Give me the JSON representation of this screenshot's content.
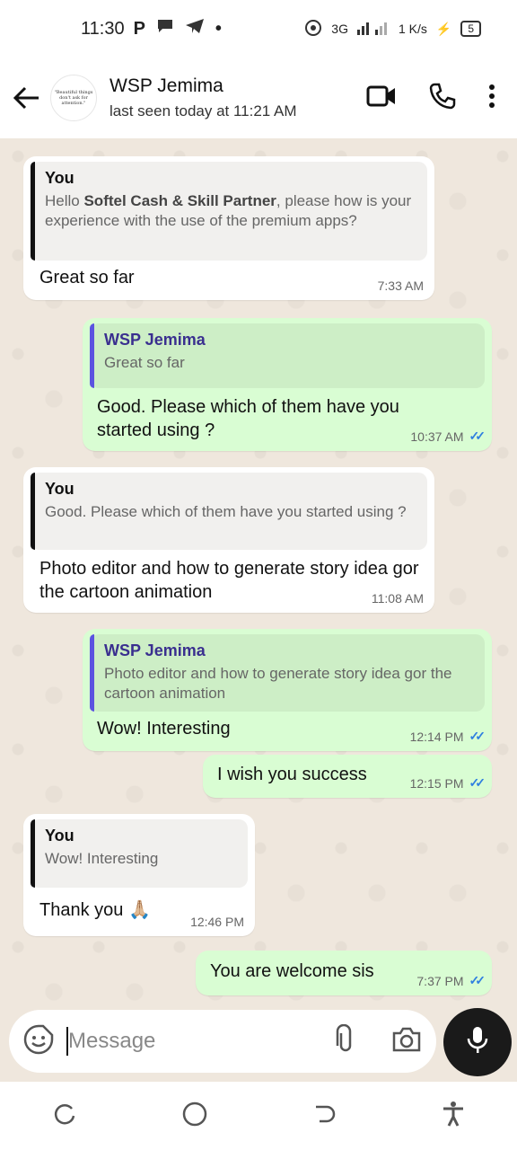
{
  "status": {
    "time": "11:30",
    "left_icons": [
      "P",
      "chat-bubble-icon",
      "telegram-icon",
      "•"
    ],
    "network": "3G",
    "speed": "1 K/s",
    "battery": "5"
  },
  "header": {
    "avatar_text": "\"Beautiful things don't ask for attention.\"",
    "name": "WSP Jemima",
    "last_seen": "last seen today at 11:21 AM"
  },
  "messages": [
    {
      "dir": "in",
      "quote_author": "You",
      "quote_pre": "Hello ",
      "quote_bold": "Softel Cash & Skill Partner",
      "quote_post": ", please how is your experience with the use of the premium apps?",
      "text": "Great so far",
      "time": "7:33 AM"
    },
    {
      "dir": "out",
      "quote_author": "WSP Jemima",
      "quote_text": "Great so far",
      "text": "Good. Please which of them have you started using ?",
      "time": "10:37 AM"
    },
    {
      "dir": "in",
      "quote_author": "You",
      "quote_text": "Good. Please which of them have you started using ?",
      "text": "Photo editor and how to generate story idea gor the cartoon animation",
      "time": "11:08 AM"
    },
    {
      "dir": "out",
      "quote_author": "WSP Jemima",
      "quote_text": "Photo editor and how to generate story idea gor the cartoon animation",
      "text": "Wow! Interesting",
      "time": "12:14 PM"
    },
    {
      "dir": "out",
      "text": "I wish you success",
      "time": "12:15 PM"
    },
    {
      "dir": "in",
      "quote_author": "You",
      "quote_text": "Wow! Interesting",
      "text": "Thank you 🙏🏼",
      "time": "12:46 PM"
    },
    {
      "dir": "out",
      "text": "You are welcome sis",
      "time": "7:37 PM"
    }
  ],
  "composer": {
    "placeholder": "Message"
  },
  "colors": {
    "outgoing": "#d9fdd3",
    "incoming": "#ffffff",
    "tick_read": "#2f7fe0",
    "reply_bar_out": "#5b53e0"
  }
}
